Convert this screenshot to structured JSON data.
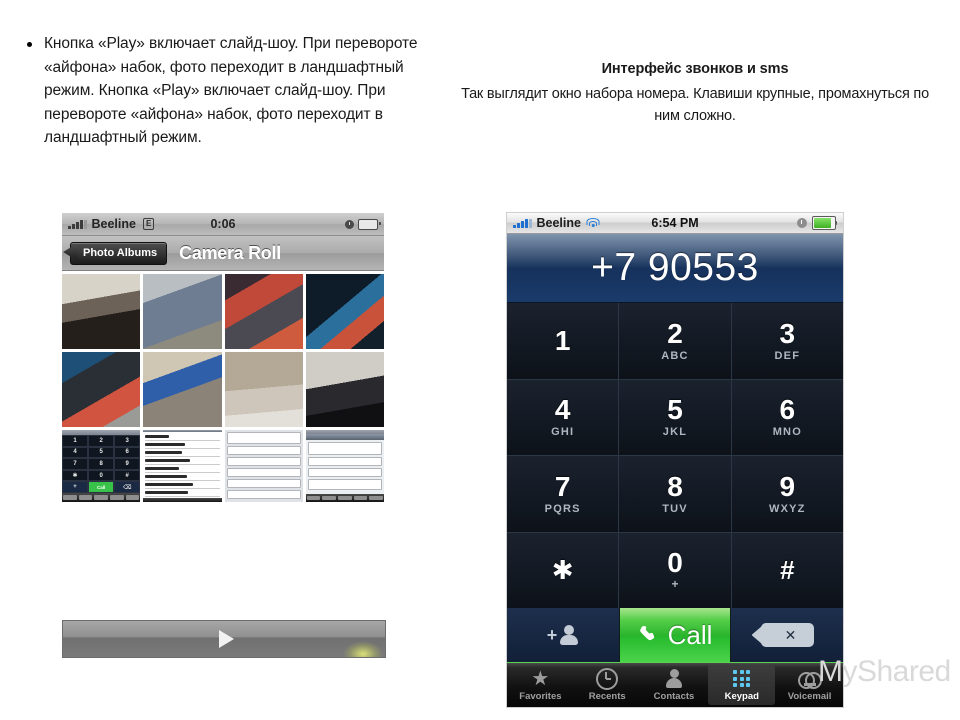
{
  "slide": {
    "bullet_text": "Кнопка «Play» включает слайд-шоу. При перевороте «айфона» набок, фото переходит в ландшафтный режим.\nКнопка «Play» включает слайд-шоу. При перевороте «айфона» набок, фото переходит в ландшафтный режим.",
    "right_title": "Интерфейс звонков и sms",
    "right_subtitle": "Так выглядит окно набора номера. Клавиши крупные, промахнуться по ним сложно.",
    "watermark": "MyShared"
  },
  "photos_phone": {
    "status": {
      "carrier": "Beeline",
      "network": "E",
      "time": "0:06"
    },
    "back_button": "Photo Albums",
    "title": "Camera Roll",
    "play_icon": "play-triangle-icon"
  },
  "dialer": {
    "status": {
      "carrier": "Beeline",
      "time": "6:54 PM",
      "wifi_icon": "wifi-icon",
      "clock_icon": "alarm-clock-icon",
      "battery_icon": "battery-icon"
    },
    "number": "+7 90553",
    "keys": [
      {
        "digit": "1",
        "letters": ""
      },
      {
        "digit": "2",
        "letters": "ABC"
      },
      {
        "digit": "3",
        "letters": "DEF"
      },
      {
        "digit": "4",
        "letters": "GHI"
      },
      {
        "digit": "5",
        "letters": "JKL"
      },
      {
        "digit": "6",
        "letters": "MNO"
      },
      {
        "digit": "7",
        "letters": "PQRS"
      },
      {
        "digit": "8",
        "letters": "TUV"
      },
      {
        "digit": "9",
        "letters": "WXYZ"
      },
      {
        "digit": "✱",
        "letters": ""
      },
      {
        "digit": "0",
        "letters": "+"
      },
      {
        "digit": "#",
        "letters": ""
      }
    ],
    "call_label": "Call",
    "add_contact_icon": "add-contact-icon",
    "delete_icon": "backspace-delete-icon",
    "tabs": [
      {
        "label": "Favorites",
        "icon": "star-icon",
        "active": false
      },
      {
        "label": "Recents",
        "icon": "clock-icon",
        "active": false
      },
      {
        "label": "Contacts",
        "icon": "person-icon",
        "active": false
      },
      {
        "label": "Keypad",
        "icon": "keypad-grid-icon",
        "active": true
      },
      {
        "label": "Voicemail",
        "icon": "voicemail-icon",
        "active": false
      }
    ]
  },
  "colors": {
    "call_green": "#29b32c",
    "keypad_dark": "#131923",
    "display_navy": "#1a3b6b",
    "accent_blue": "#5fc8f0"
  }
}
